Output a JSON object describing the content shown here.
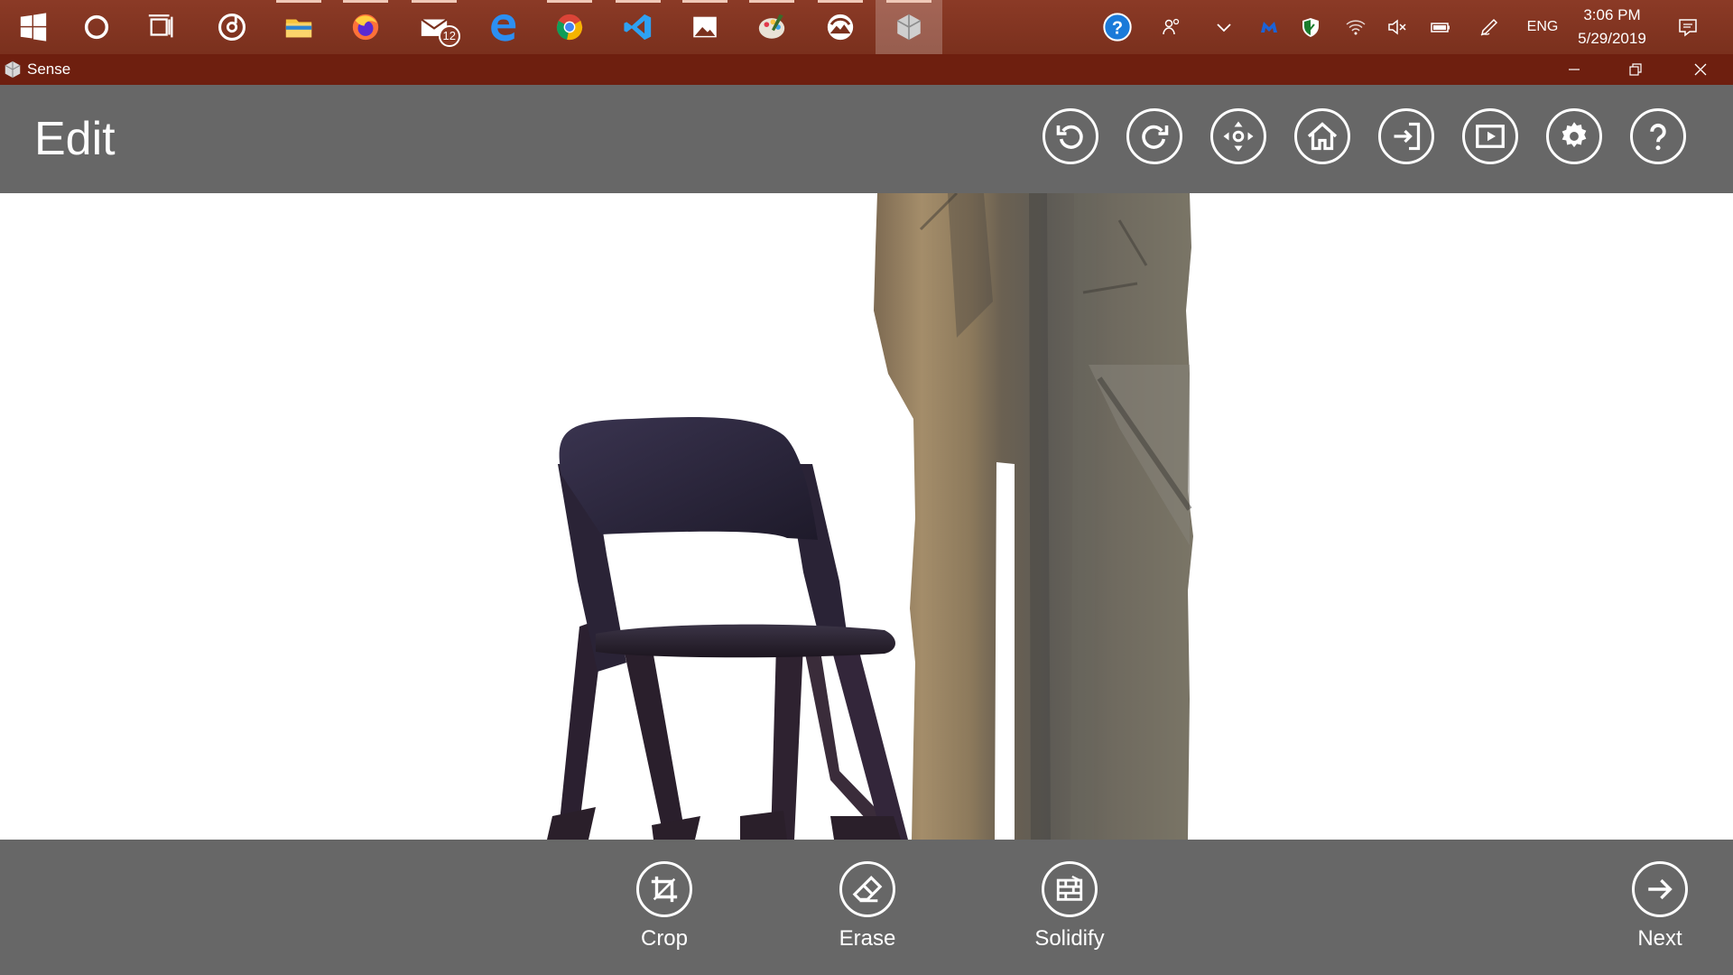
{
  "taskbar": {
    "pinned": [
      {
        "icon": "windows-start-icon"
      },
      {
        "icon": "cortana-icon"
      },
      {
        "icon": "task-view-icon"
      },
      {
        "icon": "groove-music-icon"
      },
      {
        "icon": "file-explorer-icon"
      },
      {
        "icon": "firefox-icon"
      },
      {
        "icon": "mail-icon",
        "badge": "12"
      },
      {
        "icon": "edge-icon"
      },
      {
        "icon": "chrome-icon"
      },
      {
        "icon": "vscode-icon"
      },
      {
        "icon": "photos-icon"
      },
      {
        "icon": "paint-3d-icon"
      },
      {
        "icon": "camera-app-icon"
      },
      {
        "icon": "sense-app-icon"
      }
    ],
    "tray": {
      "language": "ENG",
      "time": "3:06 PM",
      "date": "5/29/2019"
    }
  },
  "window": {
    "title": "Sense"
  },
  "header": {
    "title": "Edit",
    "buttons": [
      {
        "icon": "undo-icon"
      },
      {
        "icon": "redo-icon"
      },
      {
        "icon": "move-icon"
      },
      {
        "icon": "home-icon"
      },
      {
        "icon": "import-icon"
      },
      {
        "icon": "play-icon"
      },
      {
        "icon": "settings-icon"
      },
      {
        "icon": "help-icon"
      }
    ]
  },
  "tools": {
    "crop": "Crop",
    "erase": "Erase",
    "solidify": "Solidify",
    "next": "Next"
  },
  "colors": {
    "taskbar": "#7a301d",
    "titlebar": "#6e1f0f",
    "toolbar": "#676767",
    "viewport": "#ffffff"
  }
}
